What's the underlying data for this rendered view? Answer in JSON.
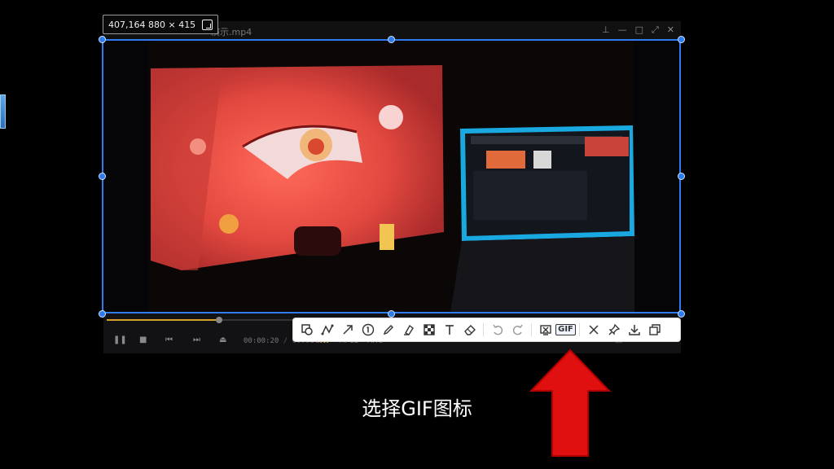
{
  "overlay": {
    "size_label": "407,164  880 × 415"
  },
  "player": {
    "title": "演示.mp4",
    "time_current": "00:00:20",
    "time_total": "/ 00:01:30",
    "tags": [
      {
        "label": "HW",
        "color": "#c9a227"
      },
      {
        "label": "AFCL",
        "color": "#666666"
      },
      {
        "label": "AHC",
        "color": "#666666"
      }
    ],
    "progress_fraction": 0.195
  },
  "toolbar": {
    "icons": [
      "shape-icon",
      "polyline-icon",
      "arrow-icon",
      "number-marker-icon",
      "pen-icon",
      "marker-icon",
      "mosaic-icon",
      "text-icon",
      "eraser-icon",
      "undo-icon",
      "redo-icon",
      "screen-record-icon",
      "gif-icon",
      "close-icon",
      "pin-icon",
      "download-icon",
      "copy-icon"
    ],
    "gif_label": "GIF"
  },
  "caption": "选择GIF图标",
  "colors": {
    "selection": "#2f7bf0",
    "arrow": "#e01010",
    "progress": "#d4a22a"
  }
}
